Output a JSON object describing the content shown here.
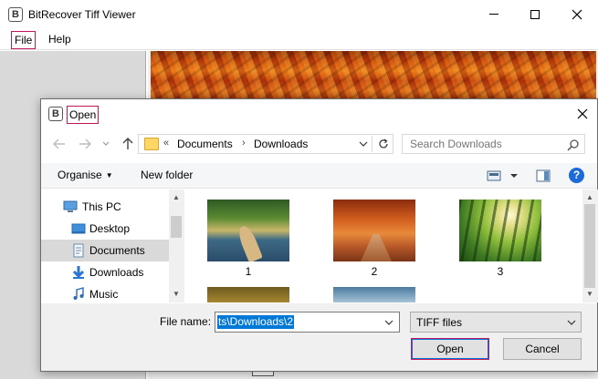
{
  "app": {
    "title": "BitRecover Tiff Viewer",
    "logo_letter": "B",
    "menu": {
      "file": "File",
      "help": "Help"
    }
  },
  "dialog": {
    "title": "Open",
    "logo_letter": "B",
    "address": {
      "chevrons": "«",
      "segments": [
        "Documents",
        "Downloads"
      ],
      "separator": "›"
    },
    "search": {
      "placeholder": "Search Downloads"
    },
    "toolbar": {
      "organise": "Organise",
      "new_folder": "New folder",
      "help": "?"
    },
    "nav_tree": [
      {
        "label": "This PC",
        "icon": "computer-icon"
      },
      {
        "label": "Desktop",
        "icon": "desktop-folder-icon"
      },
      {
        "label": "Documents",
        "icon": "documents-icon",
        "selected": true
      },
      {
        "label": "Downloads",
        "icon": "downloads-icon"
      },
      {
        "label": "Music",
        "icon": "music-icon"
      }
    ],
    "files": [
      {
        "label": "1"
      },
      {
        "label": "2"
      },
      {
        "label": "3"
      },
      {
        "label": ""
      },
      {
        "label": ""
      }
    ],
    "file_name": {
      "label": "File name:",
      "value": "ts\\Downloads\\2"
    },
    "file_type": {
      "value": "TIFF files"
    },
    "buttons": {
      "open": "Open",
      "cancel": "Cancel"
    }
  },
  "colors": {
    "focus_outline": "#c2185b",
    "selection": "#0078d7",
    "help_badge": "#1b6ad7"
  }
}
